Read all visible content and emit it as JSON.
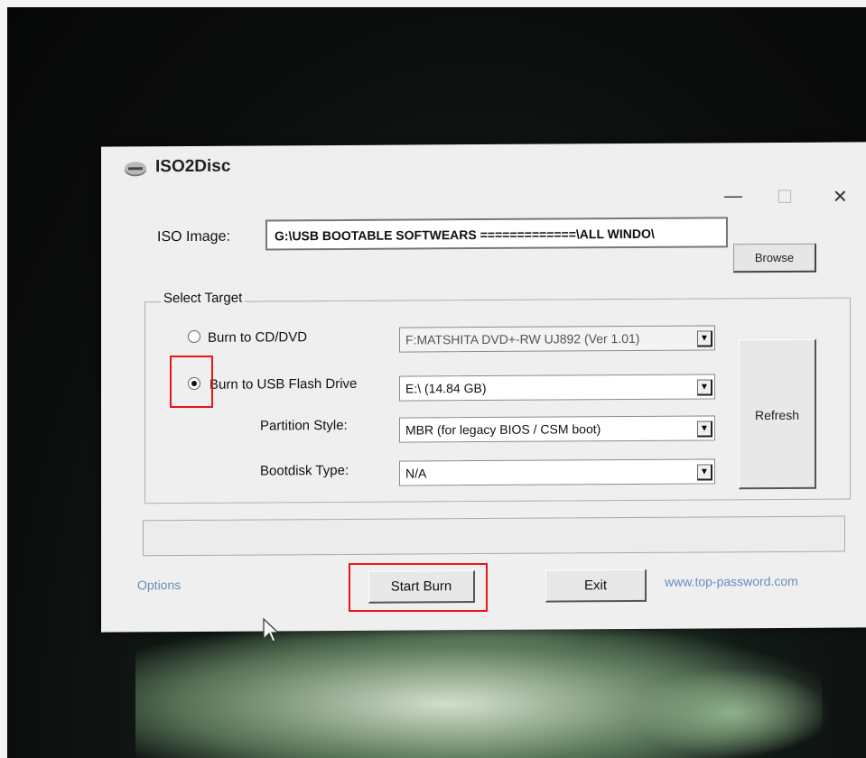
{
  "window": {
    "title": "ISO2Disc",
    "minimize_glyph": "—",
    "maximize_glyph": "☐",
    "close_glyph": "✕"
  },
  "iso": {
    "label": "ISO Image:",
    "value": "G:\\USB BOOTABLE  SOFTWEARS =============\\ALL WINDO\\",
    "browse_label": "Browse"
  },
  "select_target": {
    "group_label": "Select Target",
    "burn_cd_label": "Burn to CD/DVD",
    "burn_cd_selected": false,
    "burn_cd_value": "F:MATSHITA DVD+-RW UJ892 (Ver 1.01)",
    "burn_usb_label": "Burn to USB Flash Drive",
    "burn_usb_selected": true,
    "burn_usb_value": "E:\\ (14.84 GB)",
    "partition_label": "Partition Style:",
    "partition_value": "MBR (for legacy BIOS / CSM boot)",
    "bootdisk_label": "Bootdisk Type:",
    "bootdisk_value": "N/A",
    "refresh_label": "Refresh"
  },
  "footer": {
    "options_label": "Options",
    "start_label": "Start Burn",
    "exit_label": "Exit",
    "site_label": "www.top-password.com"
  },
  "icons": {
    "app": "drive-icon",
    "dropdown": "chevron-down-icon",
    "cursor": "mouse-cursor-icon"
  },
  "colors": {
    "highlight": "#e8141b",
    "link": "#6a8cc4"
  }
}
